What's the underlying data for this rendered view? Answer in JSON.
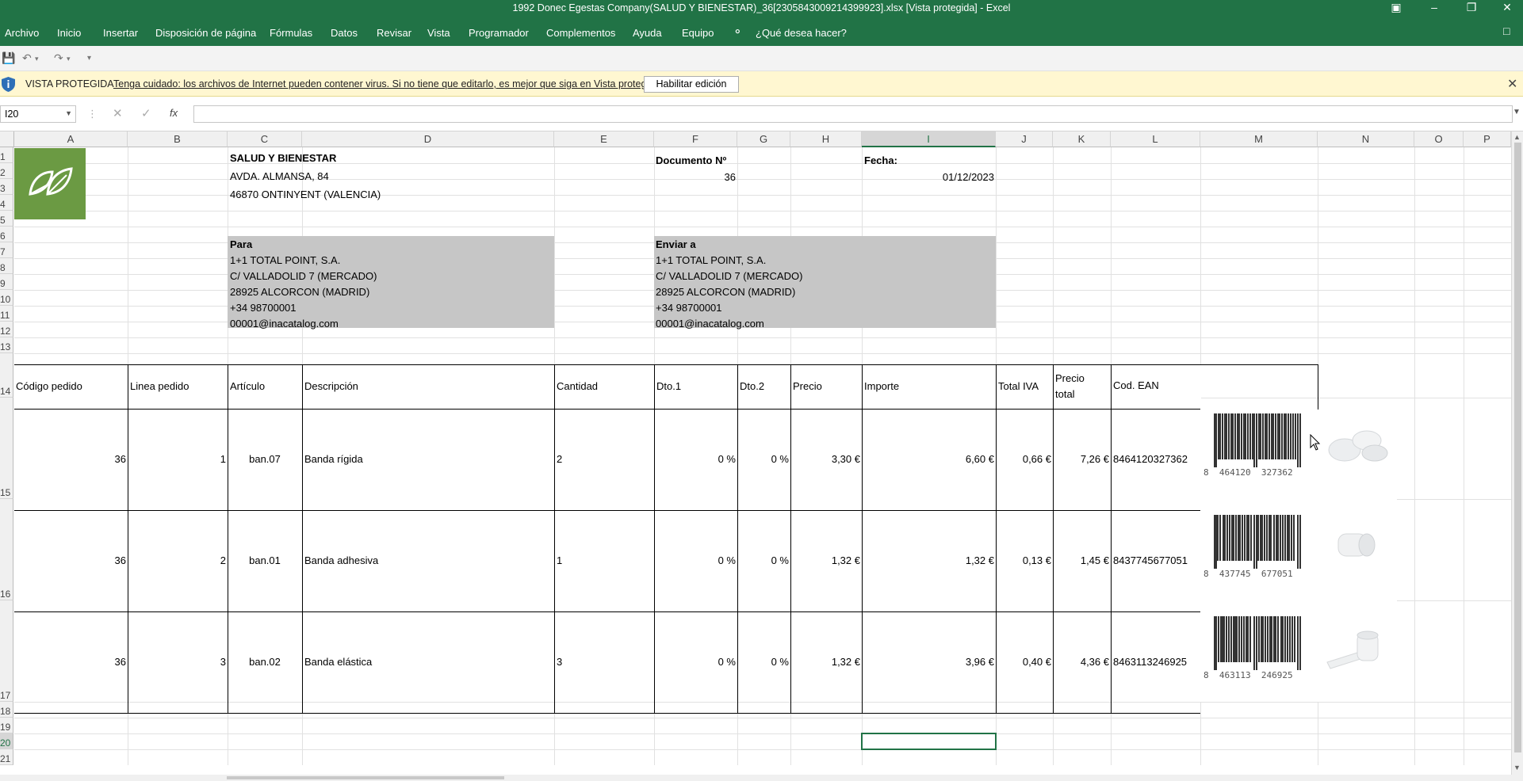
{
  "window": {
    "title": "1992 Donec Egestas Company(SALUD Y BIENESTAR)_36[2305843009214399923].xlsx  [Vista protegida]  -  Excel"
  },
  "ribbon": {
    "tabs": [
      "Archivo",
      "Inicio",
      "Insertar",
      "Disposición de página",
      "Fórmulas",
      "Datos",
      "Revisar",
      "Vista",
      "Programador",
      "Complementos",
      "Ayuda",
      "Equipo"
    ],
    "tell_me": "¿Qué desea hacer?"
  },
  "protected_view": {
    "label": "VISTA PROTEGIDA",
    "message": "Tenga cuidado: los archivos de Internet pueden contener virus. Si no tiene que editarlo, es mejor que siga en Vista protegida.",
    "enable_button": "Habilitar edición"
  },
  "formula_bar": {
    "name_box": "I20",
    "formula": ""
  },
  "columns": [
    "A",
    "B",
    "C",
    "D",
    "E",
    "F",
    "G",
    "H",
    "I",
    "J",
    "K",
    "L",
    "M",
    "N",
    "O",
    "P"
  ],
  "rows": [
    "1",
    "2",
    "3",
    "4",
    "5",
    "6",
    "7",
    "8",
    "9",
    "10",
    "11",
    "12",
    "13",
    "14",
    "15",
    "16",
    "17",
    "18",
    "19",
    "20",
    "21"
  ],
  "company": {
    "name": "SALUD Y BIENESTAR",
    "address": "AVDA. ALMANSA, 84",
    "city": "46870 ONTINYENT (VALENCIA)"
  },
  "document": {
    "number_label": "Documento Nº",
    "number": "36",
    "date_label": "Fecha:",
    "date": "01/12/2023"
  },
  "bill_to": {
    "label": "Para",
    "lines": [
      "1+1 TOTAL POINT, S.A.",
      "C/ VALLADOLID 7 (MERCADO)",
      "28925 ALCORCON (MADRID)",
      "+34 98700001",
      "00001@inacatalog.com"
    ]
  },
  "ship_to": {
    "label": "Enviar a",
    "lines": [
      "1+1 TOTAL POINT, S.A.",
      "C/ VALLADOLID 7 (MERCADO)",
      "28925 ALCORCON (MADRID)",
      "+34 98700001",
      "00001@inacatalog.com"
    ]
  },
  "table": {
    "headers": {
      "order_code": "Código pedido",
      "order_line": "Linea pedido",
      "article": "Artículo",
      "description": "Descripción",
      "quantity": "Cantidad",
      "dto1": "Dto.1",
      "dto2": "Dto.2",
      "price": "Precio",
      "amount": "Importe",
      "vat": "Total IVA",
      "total_1": "Precio",
      "total_2": "total",
      "ean": "Cod. EAN"
    },
    "rows": [
      {
        "order_code": "36",
        "line": "1",
        "article": "ban.07",
        "description": "Banda rígida",
        "quantity": "2",
        "dto1": "0 %",
        "dto2": "0 %",
        "price": "3,30 €",
        "amount": "6,60 €",
        "vat": "0,66 €",
        "total": "7,26 €",
        "ean": "8464120327362",
        "ean_lead": "8",
        "ean_left": "464120",
        "ean_right": "327362"
      },
      {
        "order_code": "36",
        "line": "2",
        "article": "ban.01",
        "description": "Banda adhesiva",
        "quantity": "1",
        "dto1": "0 %",
        "dto2": "0 %",
        "price": "1,32 €",
        "amount": "1,32 €",
        "vat": "0,13 €",
        "total": "1,45 €",
        "ean": "8437745677051",
        "ean_lead": "8",
        "ean_left": "437745",
        "ean_right": "677051"
      },
      {
        "order_code": "36",
        "line": "3",
        "article": "ban.02",
        "description": "Banda elástica",
        "quantity": "3",
        "dto1": "0 %",
        "dto2": "0 %",
        "price": "1,32 €",
        "amount": "3,96 €",
        "vat": "0,40 €",
        "total": "4,36 €",
        "ean": "8463113246925",
        "ean_lead": "8",
        "ean_left": "463113",
        "ean_right": "246925"
      }
    ]
  },
  "colors": {
    "excel_green": "#217346",
    "logo_green": "#6b9a43",
    "address_fill": "#c6c6c6",
    "protected_bar": "#fff7d1"
  }
}
